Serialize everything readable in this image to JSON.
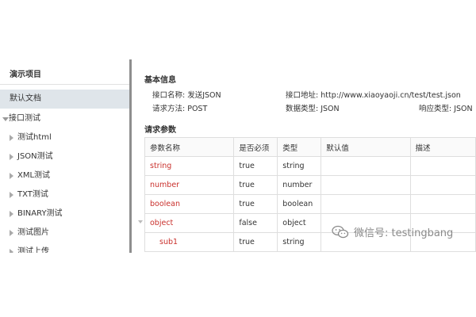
{
  "sidebar": {
    "project_title": "演示项目",
    "items": [
      {
        "label": "默认文档",
        "active": true
      },
      {
        "label": "接口测试",
        "expanded": true
      },
      {
        "label": "测试html"
      },
      {
        "label": "JSON测试"
      },
      {
        "label": "XML测试"
      },
      {
        "label": "TXT测试"
      },
      {
        "label": "BINARY测试"
      },
      {
        "label": "测试图片"
      },
      {
        "label": "测试上传"
      }
    ]
  },
  "basic": {
    "title": "基本信息",
    "name_label": "接口名称: 发送JSON",
    "url_label": "接口地址: http://www.xiaoyaoji.cn/test/test.json",
    "method_label": "请求方法: POST",
    "data_type_label": "数据类型: JSON",
    "response_type_label": "响应类型: JSON"
  },
  "params": {
    "title": "请求参数",
    "headers": [
      "参数名称",
      "是否必须",
      "类型",
      "默认值",
      "描述"
    ],
    "rows": [
      {
        "name": "string",
        "required": "true",
        "type": "string",
        "default": "",
        "desc": ""
      },
      {
        "name": "number",
        "required": "true",
        "type": "number",
        "default": "",
        "desc": ""
      },
      {
        "name": "boolean",
        "required": "true",
        "type": "boolean",
        "default": "",
        "desc": ""
      },
      {
        "name": "object",
        "required": "false",
        "type": "object",
        "default": "",
        "desc": ""
      },
      {
        "name": "sub1",
        "required": "true",
        "type": "string",
        "default": "",
        "desc": ""
      }
    ]
  },
  "watermark": {
    "text": "微信号: testingbang",
    "icon": "wechat-icon"
  }
}
